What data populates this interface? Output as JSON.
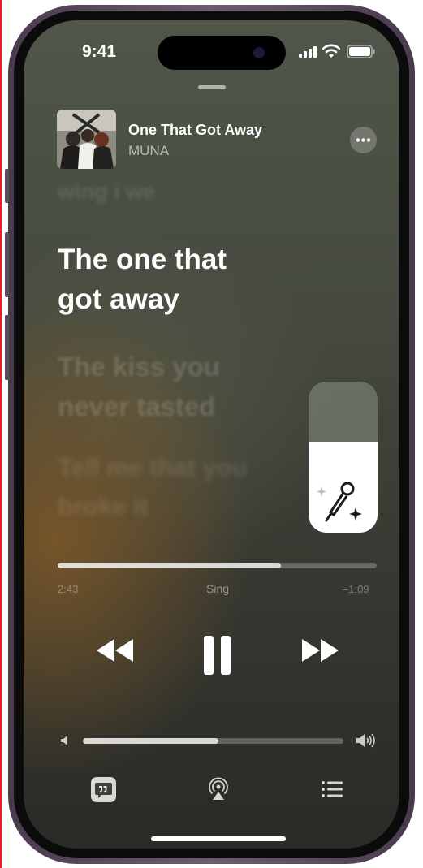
{
  "status_bar": {
    "time": "9:41"
  },
  "now_playing": {
    "title": "One That Got Away",
    "artist": "MUNA"
  },
  "lyrics": {
    "previous": "wing i we",
    "current": [
      "The one that",
      "got away"
    ],
    "next": [
      "The kiss you",
      "never tasted"
    ],
    "next2": [
      "Tell me that you",
      "broke it"
    ]
  },
  "vocal_level": 0.6,
  "playback": {
    "elapsed": "2:43",
    "mode": "Sing",
    "remaining": "–1:09",
    "progress": 0.7
  },
  "volume": {
    "level": 0.52
  },
  "icons": {
    "more": "more-icon",
    "vocal": "microphone-sparkle-icon",
    "rewind": "rewind-icon",
    "pause": "pause-icon",
    "forward": "fast-forward-icon",
    "vol_low": "volume-low-icon",
    "vol_high": "volume-high-icon",
    "lyrics": "lyrics-icon",
    "airplay": "airplay-icon",
    "queue": "queue-icon"
  }
}
